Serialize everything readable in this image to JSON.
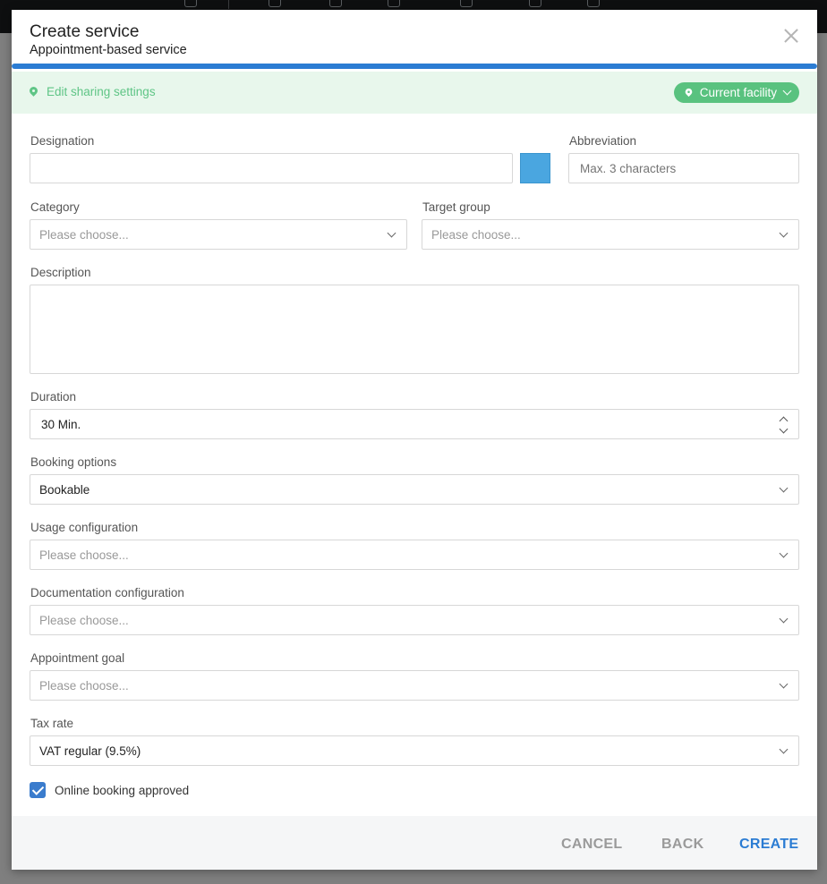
{
  "modal": {
    "title": "Create service",
    "subtitle": "Appointment-based service",
    "progress_percent": 100
  },
  "sharing": {
    "link_label": "Edit sharing settings",
    "facility_label": "Current facility"
  },
  "form": {
    "designation": {
      "label": "Designation",
      "value": ""
    },
    "color": "#4aa6e0",
    "abbreviation": {
      "label": "Abbreviation",
      "placeholder": "Max. 3 characters"
    },
    "category": {
      "label": "Category",
      "placeholder": "Please choose..."
    },
    "target_group": {
      "label": "Target group",
      "placeholder": "Please choose..."
    },
    "description": {
      "label": "Description",
      "value": ""
    },
    "duration": {
      "label": "Duration",
      "value": "30 Min."
    },
    "booking_options": {
      "label": "Booking options",
      "value": "Bookable"
    },
    "usage_configuration": {
      "label": "Usage configuration",
      "placeholder": "Please choose..."
    },
    "documentation_configuration": {
      "label": "Documentation configuration",
      "placeholder": "Please choose..."
    },
    "appointment_goal": {
      "label": "Appointment goal",
      "placeholder": "Please choose..."
    },
    "tax_rate": {
      "label": "Tax rate",
      "value": "VAT regular (9.5%)"
    },
    "online_booking": {
      "label": "Online booking approved",
      "checked": true
    }
  },
  "footer": {
    "cancel": "CANCEL",
    "back": "BACK",
    "create": "CREATE"
  },
  "colors": {
    "accent": "#2b7cd3",
    "sharing_green": "#59c27f",
    "sharing_bg": "#e8f7ec"
  }
}
